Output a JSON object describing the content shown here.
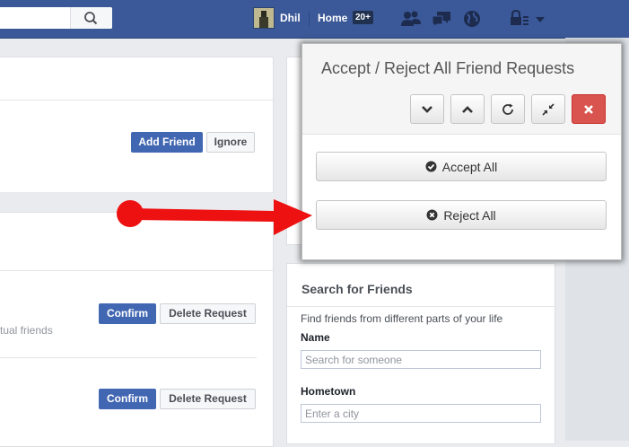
{
  "topbar": {
    "search_placeholder": "",
    "user_name": "Dhil",
    "home_label": "Home",
    "home_badge": "20+"
  },
  "left": {
    "add_friend_label": "Add Friend",
    "ignore_label": "Ignore",
    "mutual_text": "tual friends",
    "requests": [
      {
        "confirm_label": "Confirm",
        "delete_label": "Delete Request"
      },
      {
        "confirm_label": "Confirm",
        "delete_label": "Delete Request"
      }
    ]
  },
  "search_friends": {
    "title": "Search for Friends",
    "subtitle": "Find friends from different parts of your life",
    "name_label": "Name",
    "name_placeholder": "Search for someone",
    "hometown_label": "Hometown",
    "hometown_placeholder": "Enter a city"
  },
  "popup": {
    "title": "Accept / Reject All Friend Requests",
    "accept_label": "Accept All",
    "reject_label": "Reject All"
  },
  "colors": {
    "brand": "#3b5998",
    "button_blue": "#4267b2",
    "danger": "#d9534f",
    "arrow": "#ff0000"
  }
}
